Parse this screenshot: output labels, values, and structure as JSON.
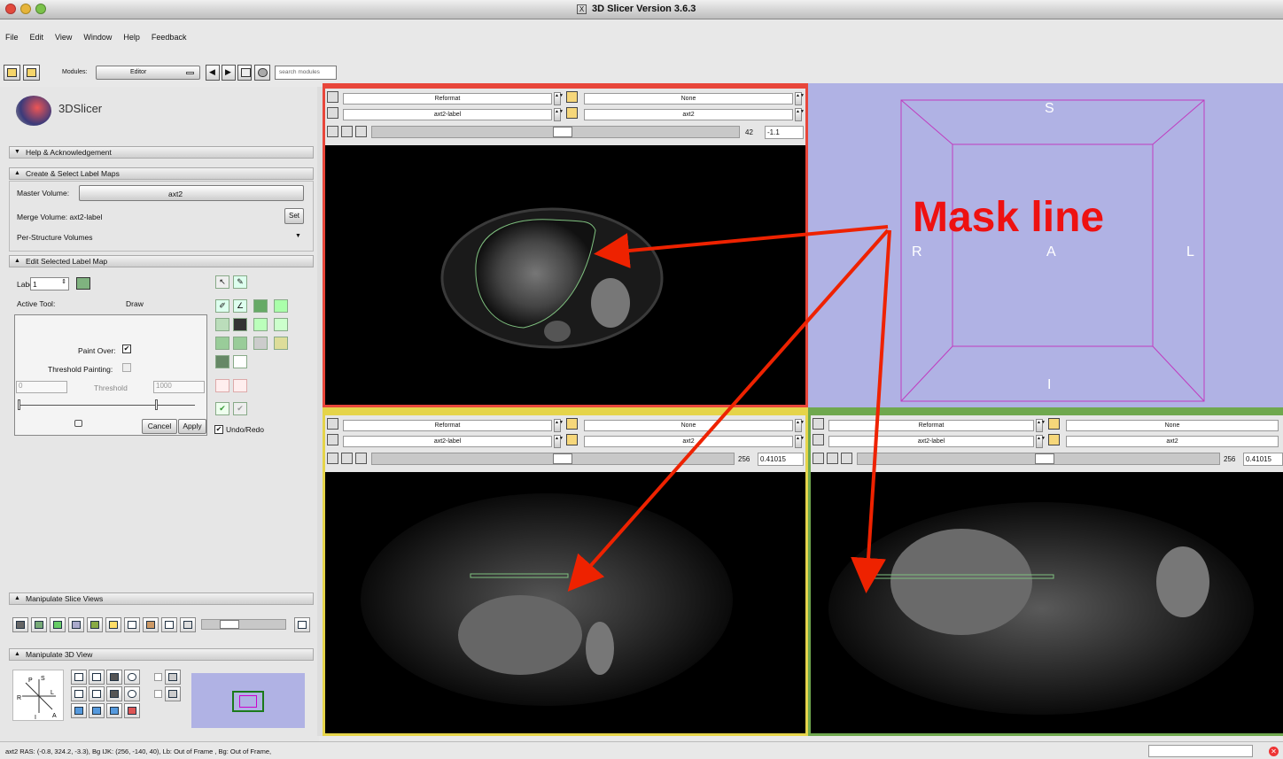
{
  "window": {
    "title": "3D Slicer Version 3.6.3"
  },
  "menu": [
    "File",
    "Edit",
    "View",
    "Window",
    "Help",
    "Feedback"
  ],
  "toolbar": {
    "modules_label": "Modules:",
    "module_value": "Editor",
    "search_placeholder": "search modules"
  },
  "logo_text": "3DSlicer",
  "sections": {
    "help": "Help & Acknowledgement",
    "create": "Create & Select Label Maps",
    "edit": "Edit Selected Label Map",
    "slice_views": "Manipulate Slice Views",
    "view3d": "Manipulate 3D View"
  },
  "create": {
    "master_label": "Master Volume:",
    "master_value": "axt2",
    "merge_label": "Merge Volume:",
    "merge_value": "axt2-label",
    "set_button": "Set",
    "per_structure": "Per-Structure Volumes"
  },
  "edit": {
    "label_label": "Label",
    "label_value": "1",
    "active_tool_label": "Active Tool:",
    "active_tool_value": "Draw",
    "paint_over": "Paint Over:",
    "threshold_painting": "Threshold Painting:",
    "threshold_min": "0",
    "threshold_label": "Threshold",
    "threshold_max": "1000",
    "cancel": "Cancel",
    "apply": "Apply",
    "undo_redo": "Undo/Redo"
  },
  "red_view": {
    "orientation": "Reformat",
    "fg": "None",
    "label": "axt2-label",
    "bg": "axt2",
    "slice_num": "42",
    "offset": "-1.1"
  },
  "yellow_view": {
    "orientation": "Reformat",
    "fg": "None",
    "label": "axt2-label",
    "bg": "axt2",
    "slice_num": "256",
    "offset": "0.41015"
  },
  "green_view": {
    "orientation": "Reformat",
    "fg": "None",
    "label": "axt2-label",
    "bg": "axt2",
    "slice_num": "256",
    "offset": "0.41015"
  },
  "view3d": {
    "s": "S",
    "i": "I",
    "r": "R",
    "l": "L",
    "a": "A"
  },
  "annotation": "Mask line",
  "status": "axt2 RAS: (-0.8, 324.2, -3.3), Bg IJK: (256, -140, 40), Lb: Out of Frame , Bg: Out of Frame,",
  "colors": {
    "red": "#e8463a",
    "yellow": "#e5d44a",
    "green": "#6fa84e",
    "view3d_bg": "#b0b2e4",
    "annotation": "#ee1111"
  }
}
